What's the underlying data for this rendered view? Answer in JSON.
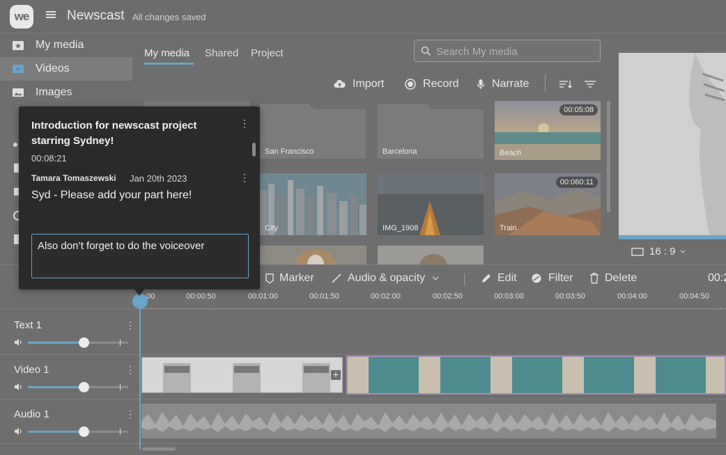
{
  "app": {
    "logo_text": "we",
    "menu_icon": "hamburger-icon",
    "title": "Newscast",
    "save_status": "All changes saved"
  },
  "sidebar": {
    "items": [
      {
        "label": "My media",
        "icon": "star-folder-icon",
        "active": false
      },
      {
        "label": "Videos",
        "icon": "video-icon",
        "active": true
      },
      {
        "label": "Images",
        "icon": "image-icon",
        "active": false
      }
    ]
  },
  "media": {
    "tabs": [
      "My media",
      "Shared",
      "Project"
    ],
    "active_tab": "My media",
    "search_placeholder": "Search My media",
    "toolbar": {
      "import": "Import",
      "record": "Record",
      "narrate": "Narrate"
    },
    "items": [
      {
        "label": "San Francisco",
        "kind": "folder"
      },
      {
        "label": "Barcelona",
        "kind": "folder"
      },
      {
        "label": "Beach",
        "kind": "video",
        "duration": "00:05:08"
      },
      {
        "label": "City",
        "kind": "video"
      },
      {
        "label": "IMG_1908",
        "kind": "video"
      },
      {
        "label": "Train",
        "kind": "video",
        "duration": "00:060:11"
      }
    ]
  },
  "preview": {
    "aspect_ratio": "16 : 9"
  },
  "editor_toolbar": {
    "marker": "Marker",
    "audio_opacity": "Audio & opacity",
    "edit": "Edit",
    "filter": "Filter",
    "delete": "Delete",
    "time_partial": "00:2"
  },
  "ruler": {
    "ticks": [
      "00",
      "00:00:50",
      "00:01:00",
      "00:01:50",
      "00:02:00",
      "00:02:50",
      "00:03:00",
      "00:03:50",
      "00:04:00",
      "00:04:50"
    ]
  },
  "tracks": [
    {
      "name": "Text 1",
      "volume": 0.56
    },
    {
      "name": "Video 1",
      "volume": 0.56
    },
    {
      "name": "Audio 1",
      "volume": 0.56
    }
  ],
  "comment_popup": {
    "title": "Introduction for newscast project starring Sydney!",
    "timestamp": "00:08:21",
    "comment": {
      "author": "Tamara Tomaszewski",
      "date": "Jan 20th 2023",
      "text": "Syd - Please add your part here!"
    },
    "reply_value": "Also don’t forget to do the voiceover"
  },
  "colors": {
    "accent": "#6aa4c8",
    "popup_bg": "#2a2a2a",
    "overlay": "#6e6e6e"
  }
}
